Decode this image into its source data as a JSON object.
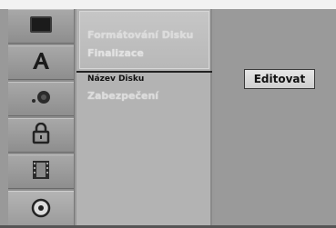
{
  "sidebar": {
    "tabs": [
      {
        "icon": "screen-icon"
      },
      {
        "icon": "font-a-icon"
      },
      {
        "icon": "audio-icon"
      },
      {
        "icon": "lock-icon"
      },
      {
        "icon": "film-icon"
      },
      {
        "icon": "disc-icon"
      }
    ],
    "selected_index": 5
  },
  "menu": {
    "items": [
      {
        "label": "Formátování Disku"
      },
      {
        "label": "Finalizace"
      },
      {
        "label": "Název Disku"
      },
      {
        "label": "Zabezpečení"
      }
    ]
  },
  "panel": {
    "button_label": "Editovat"
  }
}
